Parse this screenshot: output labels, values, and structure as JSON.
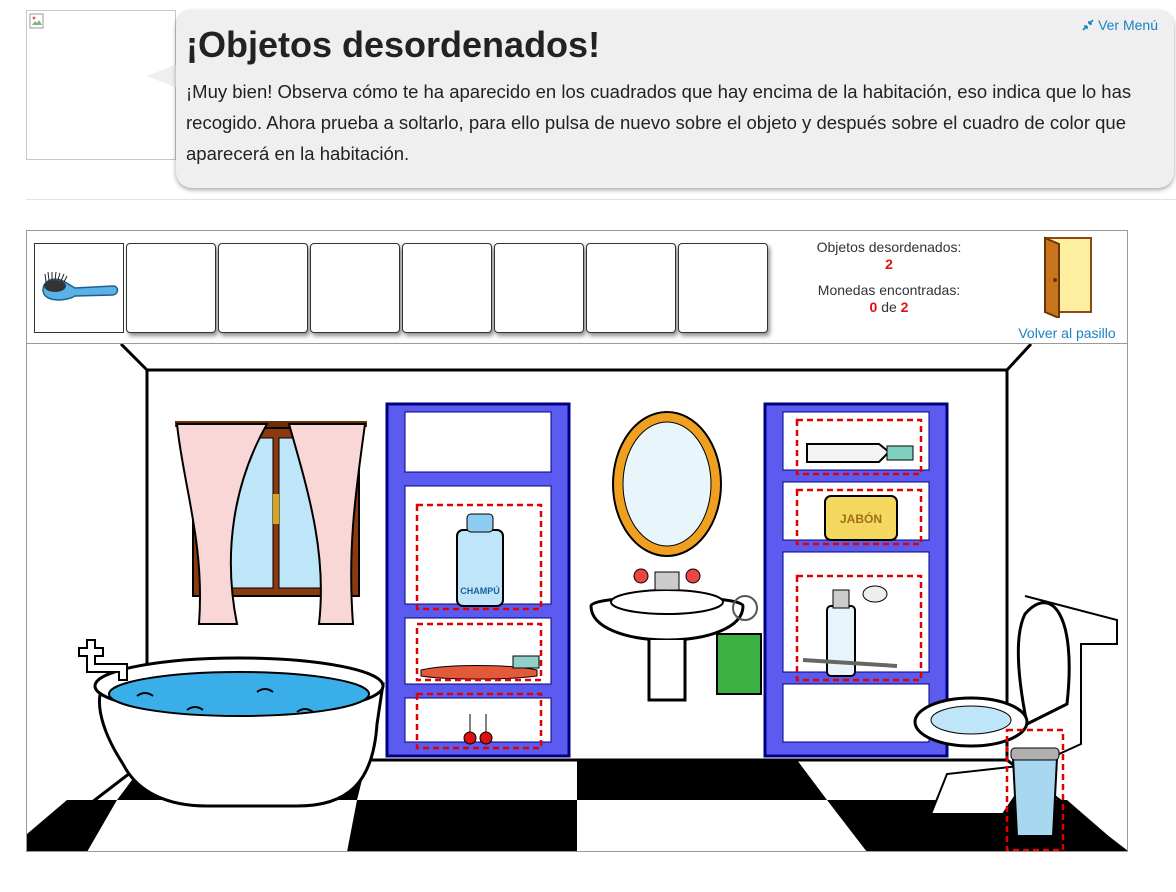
{
  "header": {
    "title": "¡Objetos desordenados!",
    "message": "¡Muy bien! Observa cómo te ha aparecido en los cuadrados que hay encima de la habitación, eso indica que lo has recogido. Ahora prueba a soltarlo, para ello pulsa de nuevo sobre el objeto y después sobre el cuadro de color que aparecerá en la habitación.",
    "ver_menu": "Ver Menú",
    "ver_menu_icon": "shrink-arrows-icon"
  },
  "counters": {
    "objects_label": "Objetos desordenados:",
    "objects_value": "2",
    "coins_label": "Monedas encontradas:",
    "coins_found": "0",
    "coins_separator": "de",
    "coins_total": "2"
  },
  "back": {
    "label": "Volver al pasillo",
    "icon": "door-icon"
  },
  "inventory": {
    "slots": [
      {
        "item": "hairbrush",
        "selected": true
      },
      {
        "item": null
      },
      {
        "item": null
      },
      {
        "item": null
      },
      {
        "item": null
      },
      {
        "item": null
      },
      {
        "item": null
      },
      {
        "item": null
      }
    ]
  },
  "room": {
    "labels": {
      "soap": "JABÓN",
      "shampoo": "CHAMPÚ"
    },
    "colors": {
      "shelf": "#5b5bf0",
      "shelf_dark": "#000080",
      "water": "#3aaee8",
      "target_border": "#e00000",
      "mirror_frame": "#f0a020",
      "towel": "#3cb043"
    }
  }
}
